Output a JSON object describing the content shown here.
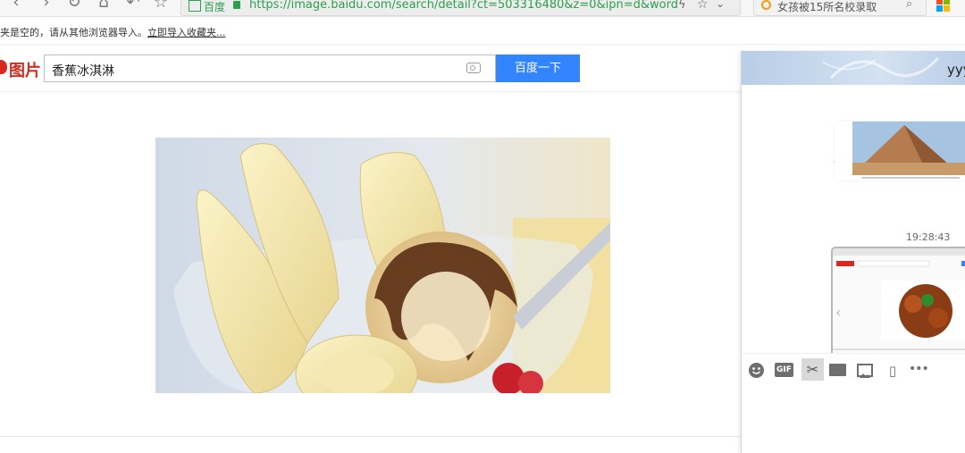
{
  "browser": {
    "site_label": "百度",
    "url": "https://image.baidu.com/search/detail?ct=503316480&z=0&ipn=d&word",
    "search_placeholder": "女孩被15所名校录取"
  },
  "bookmark_bar": {
    "message": "夹是空的，请从其他浏览器导入。",
    "import_link": "立即导入收藏夹..."
  },
  "header": {
    "logo_text": "图片",
    "query": "香蕉冰淇淋",
    "search_button": "百度一下"
  },
  "chat": {
    "contact_name": "yyy",
    "timestamp": "19:28:43",
    "toolbar": {
      "gif_label": "GIF",
      "more_label": "•••",
      "icons": [
        "emoji-icon",
        "gif-icon",
        "scissors-icon",
        "folder-icon",
        "image-icon",
        "shake-icon",
        "more-icon"
      ]
    }
  },
  "colors": {
    "accent": "#3385ff",
    "logo_red": "#d52b1e",
    "url_green": "#2aa14a"
  }
}
